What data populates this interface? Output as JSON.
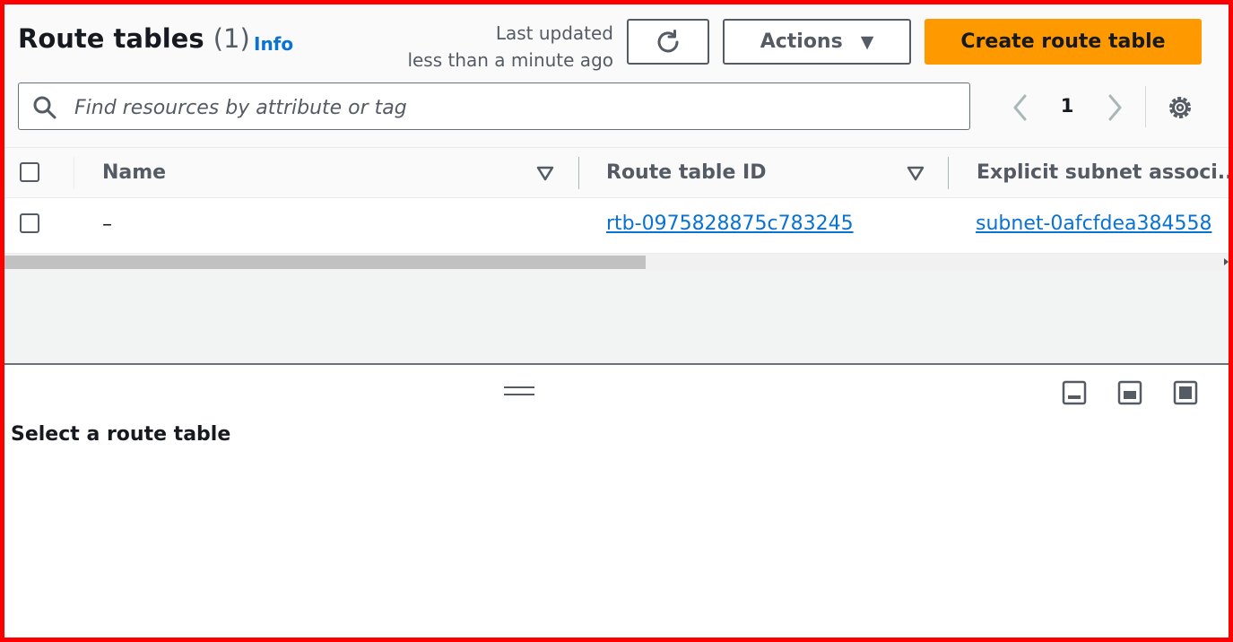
{
  "header": {
    "title": "Route tables",
    "count": "(1)",
    "info_label": "Info",
    "last_updated_line1": "Last updated",
    "last_updated_line2": "less than a minute ago",
    "actions_label": "Actions",
    "create_label": "Create route table"
  },
  "search": {
    "placeholder": "Find resources by attribute or tag"
  },
  "pagination": {
    "current_page": "1"
  },
  "table": {
    "columns": [
      "Name",
      "Route table ID",
      "Explicit subnet associ..."
    ],
    "rows": [
      {
        "name": "–",
        "route_table_id": "rtb-0975828875c783245",
        "explicit_subnet": "subnet-0afcfdea384558"
      }
    ]
  },
  "details": {
    "title": "Select a route table"
  },
  "icons": {
    "search": "search-icon",
    "refresh": "refresh-icon",
    "caret": "caret-down-icon",
    "prev": "chevron-left-icon",
    "next": "chevron-right-icon",
    "settings": "gear-icon",
    "sort": "sort-caret-icon",
    "drag": "drag-handle-icon",
    "layouts": [
      "panel-bottom-small-icon",
      "panel-bottom-medium-icon",
      "panel-bottom-large-icon"
    ]
  },
  "colors": {
    "accent": "#ff9900",
    "link": "#0972d3",
    "frame": "#ff0000"
  }
}
